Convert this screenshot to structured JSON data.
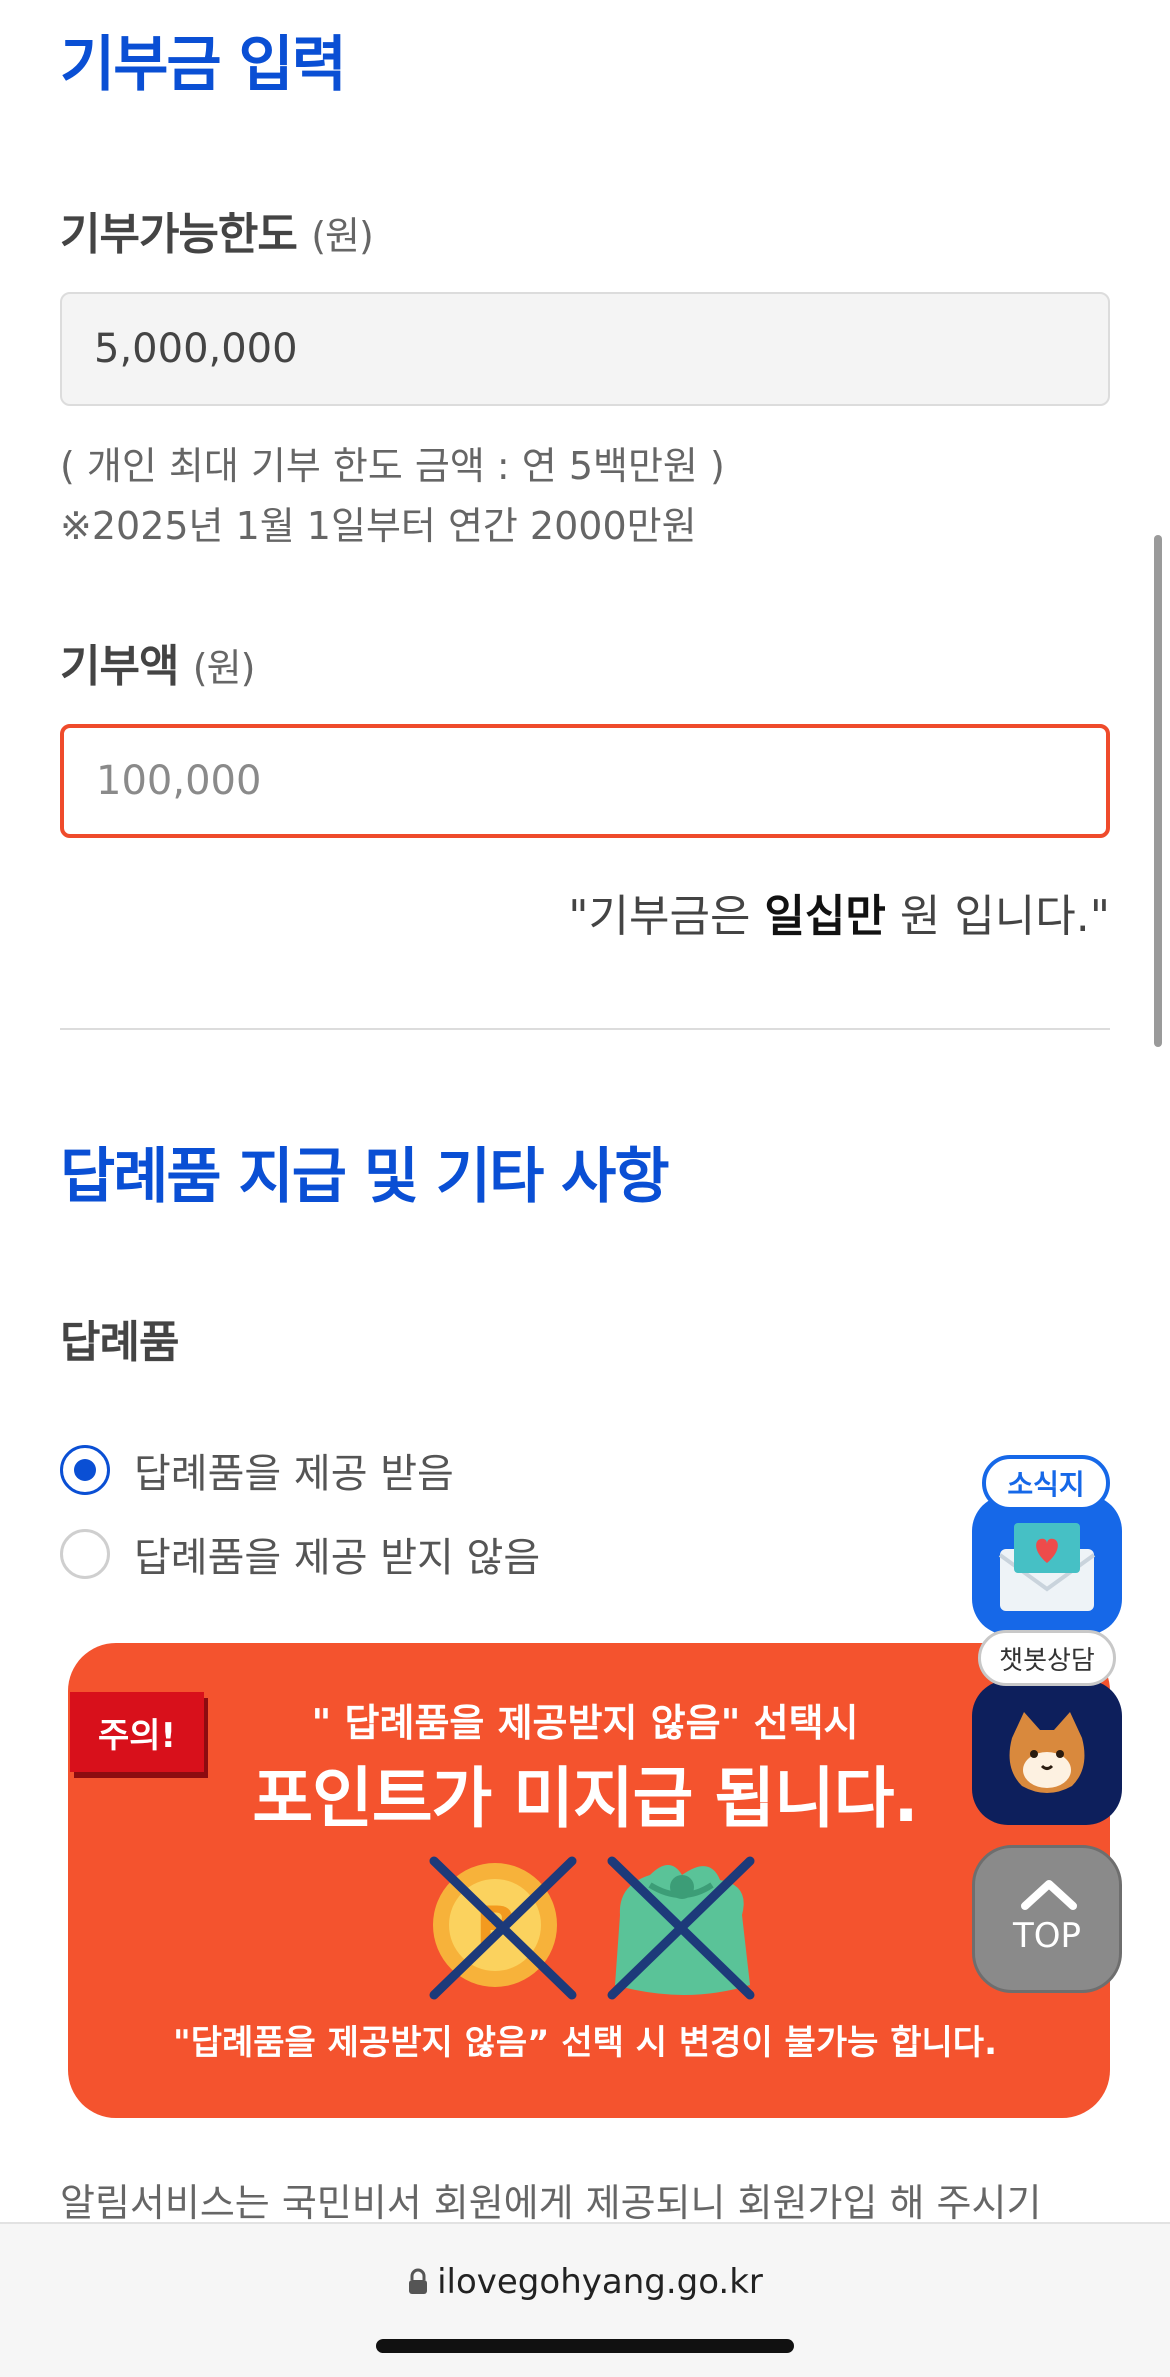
{
  "section1": {
    "title": "기부금 입력",
    "limit_label": "기부가능한도",
    "limit_unit": "(원)",
    "limit_value": "5,000,000",
    "note_line1": "( 개인 최대 기부 한도 금액 : 연 5백만원 )",
    "note_line2": "※2025년 1월 1일부터 연간 2000만원",
    "amount_label": "기부액",
    "amount_unit": "(원)",
    "amount_value": "100,000",
    "amount_text_pre": "\"기부금은 ",
    "amount_text_bold": "일십만",
    "amount_text_post": " 원 입니다.\""
  },
  "section2": {
    "title": "답례품 지급 및 기타 사항",
    "gift_label": "답례품",
    "options": [
      {
        "label": "답례품을 제공 받음",
        "selected": true
      },
      {
        "label": "답례품을 제공 받지 않음",
        "selected": false
      }
    ]
  },
  "banner": {
    "tag": "주의!",
    "line1": "\" 답례품을 제공받지 않음\" 선택시",
    "line2": "포인트가 미지급 됩니다.",
    "line3": "\"답례품을 제공받지 않음” 선택 시 변경이 불가능 합니다."
  },
  "footer_text": "알림서비스는 국민비서 회원에게 제공되니 회원가입 해 주시기",
  "floating": {
    "newsletter_label": "소식지",
    "chatbot_label": "챗봇상담",
    "top_label": "TOP"
  },
  "browser": {
    "url": "ilovegohyang.go.kr"
  },
  "colors": {
    "primary": "#0a4fd4",
    "alert": "#f4532e",
    "active_border": "#ef4b2b"
  }
}
